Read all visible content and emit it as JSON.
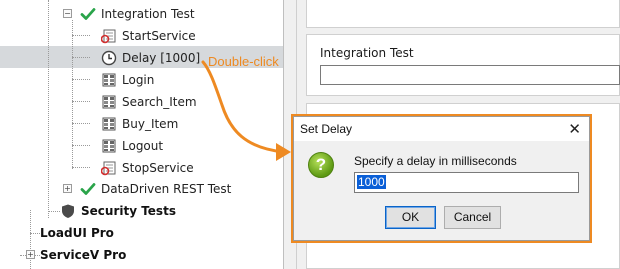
{
  "tree": {
    "items": [
      {
        "label": "Integration Test",
        "icon": "check-icon",
        "bold": false
      },
      {
        "label": "StartService",
        "icon": "start-service-icon",
        "bold": false
      },
      {
        "label": "Delay [1000]",
        "icon": "clock-icon",
        "bold": false,
        "selected": true
      },
      {
        "label": "Login",
        "icon": "grid-step-icon",
        "bold": false
      },
      {
        "label": "Search_Item",
        "icon": "grid-step-icon",
        "bold": false
      },
      {
        "label": "Buy_Item",
        "icon": "grid-step-icon",
        "bold": false
      },
      {
        "label": "Logout",
        "icon": "grid-step-icon",
        "bold": false
      },
      {
        "label": "StopService",
        "icon": "stop-service-icon",
        "bold": false
      },
      {
        "label": "DataDriven REST Test",
        "icon": "check-icon",
        "bold": false
      },
      {
        "label": "Security Tests",
        "icon": "shield-icon",
        "bold": true
      },
      {
        "label": "LoadUI Pro",
        "icon": "",
        "bold": true
      },
      {
        "label": "ServiceV Pro",
        "icon": "",
        "bold": true
      }
    ]
  },
  "annotation": {
    "text": "Double-click",
    "color": "#ee8a22"
  },
  "panel": {
    "field_title": "Integration Test",
    "field_value": ""
  },
  "dialog": {
    "title": "Set Delay",
    "close_glyph": "✕",
    "prompt": "Specify a delay in milliseconds",
    "input_value": "1000",
    "ok_label": "OK",
    "cancel_label": "Cancel",
    "icon_glyph": "?"
  },
  "colors": {
    "accent": "#ee8a22",
    "check_green": "#2aa44a",
    "selection_bg": "#d6d9dc",
    "selection_blue": "#0a5fd7"
  }
}
